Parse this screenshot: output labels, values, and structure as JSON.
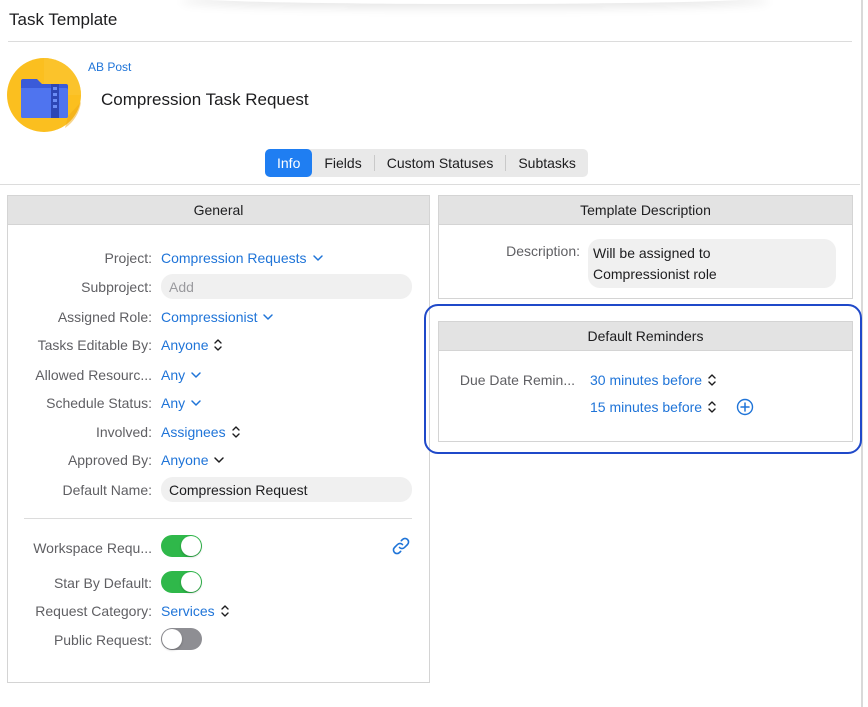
{
  "window": {
    "title": "Task Template"
  },
  "template": {
    "org": "AB Post",
    "name": "Compression Task Request"
  },
  "tabs": [
    {
      "label": "Info",
      "active": true
    },
    {
      "label": "Fields",
      "active": false
    },
    {
      "label": "Custom Statuses",
      "active": false
    },
    {
      "label": "Subtasks",
      "active": false
    }
  ],
  "general": {
    "title": "General",
    "project": {
      "label": "Project:",
      "value": "Compression Requests"
    },
    "subproject": {
      "label": "Subproject:",
      "placeholder": "Add"
    },
    "assigned_role": {
      "label": "Assigned Role:",
      "value": "Compressionist"
    },
    "tasks_editable_by": {
      "label": "Tasks Editable By:",
      "value": "Anyone"
    },
    "allowed_resources": {
      "label": "Allowed Resourc...",
      "value": "Any"
    },
    "schedule_status": {
      "label": "Schedule Status:",
      "value": "Any"
    },
    "involved": {
      "label": "Involved:",
      "value": "Assignees"
    },
    "approved_by": {
      "label": "Approved By:",
      "value": "Anyone"
    },
    "default_name": {
      "label": "Default Name:",
      "value": "Compression Request"
    },
    "workspace_request": {
      "label": "Workspace Requ...",
      "on": true
    },
    "star_by_default": {
      "label": "Star By Default:",
      "on": true
    },
    "request_category": {
      "label": "Request Category:",
      "value": "Services"
    },
    "public_request": {
      "label": "Public Request:",
      "on": false
    }
  },
  "description_panel": {
    "title": "Template Description",
    "label": "Description:",
    "line1": "Will be assigned to",
    "line2": "Compressionist role"
  },
  "reminders_panel": {
    "title": "Default Reminders",
    "label": "Due Date Remin...",
    "reminders": [
      "30 minutes before",
      "15 minutes before"
    ]
  },
  "colors": {
    "accent": "#1f7ef2",
    "link": "#1f74d8",
    "toggle_on": "#2fb84a",
    "toggle_off": "#8e8e93",
    "focus_ring": "#1f49c9"
  },
  "icons": [
    "folder-zip-app-icon",
    "chevron-down-icon",
    "up-down-arrows-icon",
    "link-icon",
    "add-circle-icon"
  ]
}
